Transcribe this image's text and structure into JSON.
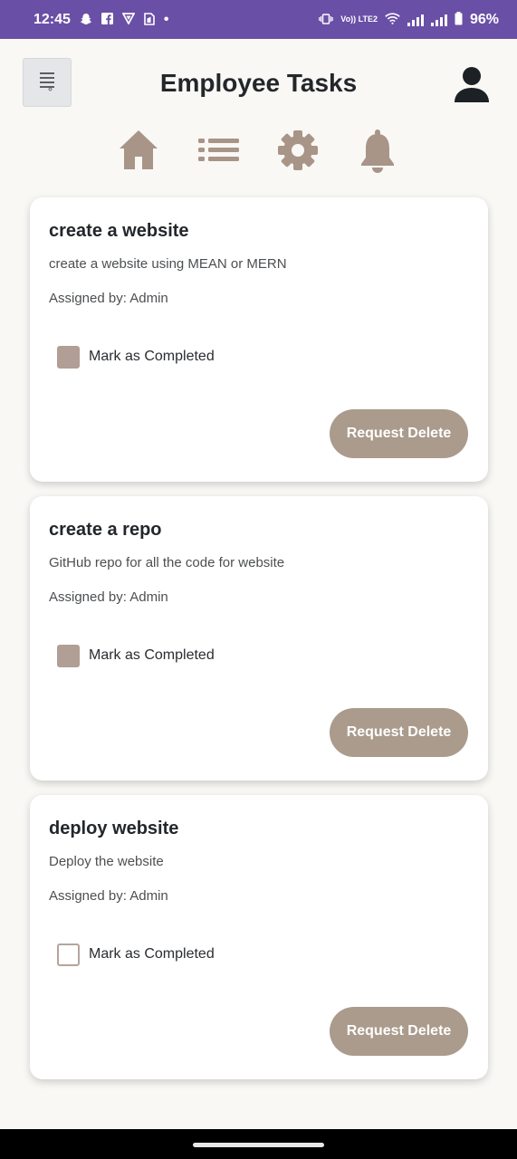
{
  "status_bar": {
    "time": "12:45",
    "dot": "•",
    "volte": "Vo)) LTE2",
    "battery": "96%"
  },
  "header": {
    "title": "Employee Tasks"
  },
  "nav": [
    "home-icon",
    "list-icon",
    "settings-icon",
    "bell-icon"
  ],
  "colors": {
    "status_bar": "#6a4fa6",
    "accent": "#aa9b8c",
    "icon": "#a89587",
    "background": "#f9f8f5"
  },
  "tasks": [
    {
      "title": "create a website",
      "description": "create a website using MEAN or MERN",
      "assigned": "Assigned by: Admin",
      "checkbox_label": "Mark as Completed",
      "completed": true,
      "button": "Request Delete"
    },
    {
      "title": "create a repo",
      "description": "GitHub repo for all the code for website",
      "assigned": "Assigned by: Admin",
      "checkbox_label": "Mark as Completed",
      "completed": true,
      "button": "Request Delete"
    },
    {
      "title": "deploy website",
      "description": "Deploy the website",
      "assigned": "Assigned by: Admin",
      "checkbox_label": "Mark as Completed",
      "completed": false,
      "button": "Request Delete"
    }
  ]
}
